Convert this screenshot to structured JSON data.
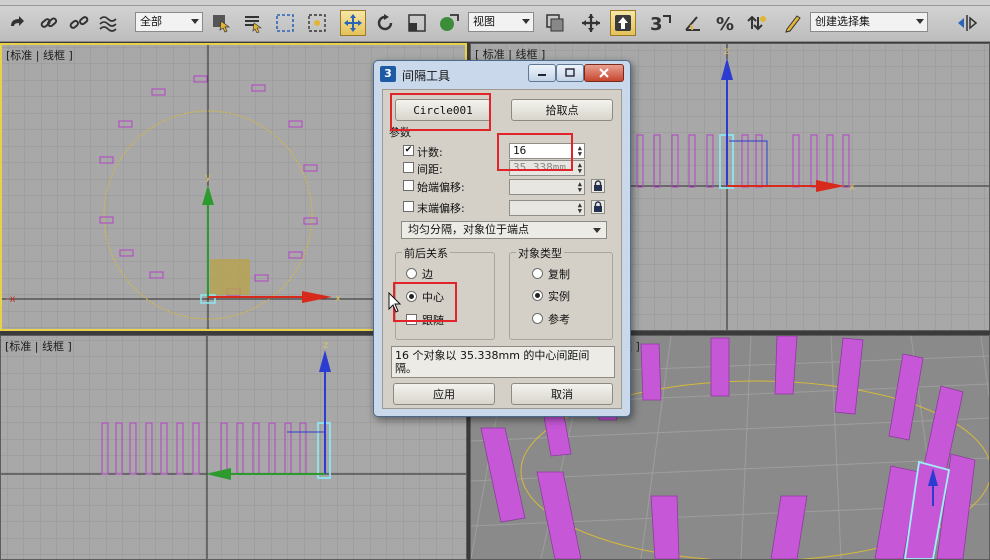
{
  "toolbar": {
    "selection_filter": "全部",
    "ref_coord": "视图",
    "named_selection": "创建选择集"
  },
  "viewports": {
    "top_left": {
      "label": "[标准 | 线框 ]"
    },
    "top_right": {
      "label": "[ 标准 | 线框 ]"
    },
    "bottom_left": {
      "label": "[标准 | 线框 ]"
    },
    "bottom_right": {
      "label": "理 ]"
    }
  },
  "axes": {
    "x": "x",
    "y": "y",
    "z": "z"
  },
  "dialog": {
    "title": "间隔工具",
    "path_button": "Circle001",
    "pick_points_button": "拾取点",
    "params_title": "参数",
    "count_label": "计数:",
    "count_value": "16",
    "spacing_label": "间距:",
    "spacing_value": "35.338mm",
    "start_offset_label": "始端偏移:",
    "end_offset_label": "末端偏移:",
    "distribution": "均匀分隔，对象位于端点",
    "context_title": "前后关系",
    "context_options": [
      "边",
      "中心",
      "跟随"
    ],
    "type_title": "对象类型",
    "type_options": [
      "复制",
      "实例",
      "参考"
    ],
    "status_text": "16 个对象以 35.338mm 的中心间距间隔。",
    "apply_button": "应用",
    "cancel_button": "取消"
  },
  "colors": {
    "accent_red": "#e0242a",
    "object_magenta": "#b24cc4",
    "path_yellow": "#d8b93a",
    "viewport_grid": "#a8a8a8"
  }
}
